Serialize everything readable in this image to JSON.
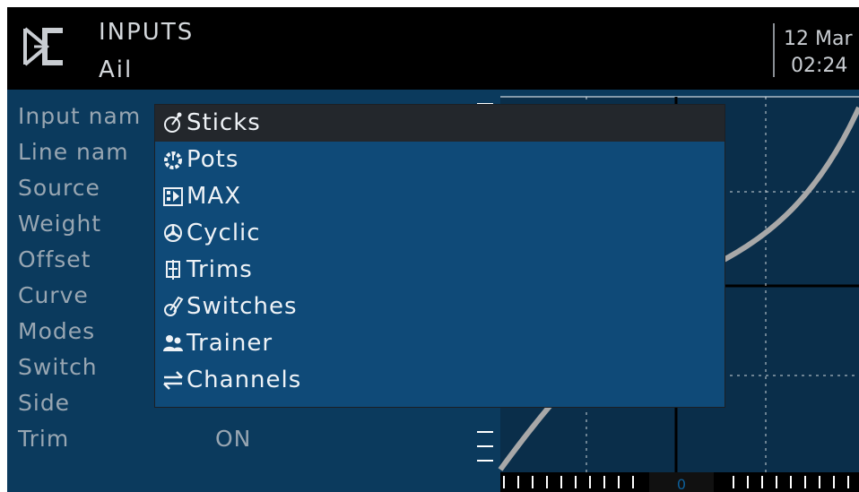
{
  "header": {
    "logo_icon": "edgetx-logo",
    "title": "INPUTS",
    "subtitle": "Ail",
    "date": "12 Mar",
    "time": "02:24"
  },
  "form": {
    "labels": [
      "Input nam",
      "Line nam",
      "Source",
      "Weight",
      "Offset",
      "Curve",
      "Modes",
      "Switch",
      "Side",
      "Trim"
    ],
    "trim_value": "ON"
  },
  "graph": {
    "center_label": "0"
  },
  "popup": {
    "items": [
      {
        "label": "Sticks",
        "icon": "stick-icon",
        "selected": true
      },
      {
        "label": "Pots",
        "icon": "pot-icon",
        "selected": false
      },
      {
        "label": "MAX",
        "icon": "max-icon",
        "selected": false
      },
      {
        "label": "Cyclic",
        "icon": "cyclic-icon",
        "selected": false
      },
      {
        "label": "Trims",
        "icon": "trim-icon",
        "selected": false
      },
      {
        "label": "Switches",
        "icon": "switch-icon",
        "selected": false
      },
      {
        "label": "Trainer",
        "icon": "trainer-icon",
        "selected": false
      },
      {
        "label": "Channels",
        "icon": "channels-icon",
        "selected": false
      }
    ]
  },
  "colors": {
    "background": "#0b3a5d",
    "popup": "#0f4a78",
    "selected": "#23272c",
    "topbar": "#000000"
  }
}
